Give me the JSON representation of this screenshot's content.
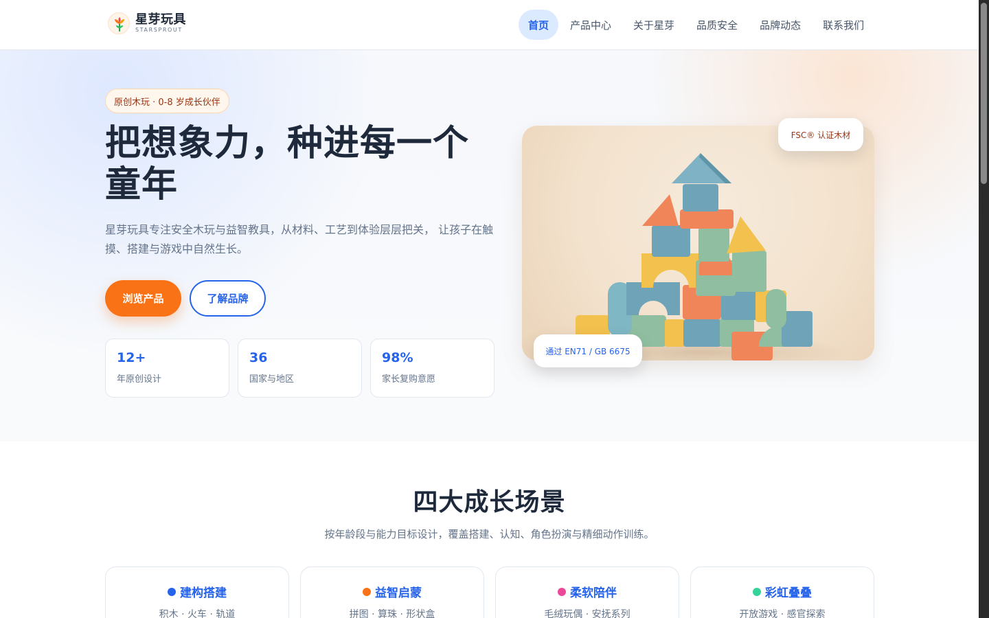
{
  "header": {
    "brand_name": "星芽玩具",
    "brand_sub": "STARSPROUT",
    "nav": [
      {
        "label": "首页",
        "active": true
      },
      {
        "label": "产品中心"
      },
      {
        "label": "关于星芽"
      },
      {
        "label": "品质安全"
      },
      {
        "label": "品牌动态"
      },
      {
        "label": "联系我们"
      }
    ]
  },
  "hero": {
    "pill": "原创木玩 · 0-8 岁成长伙伴",
    "title": "把想象力，种进每一个童年",
    "description": "星芽玩具专注安全木玩与益智教具，从材料、工艺到体验层层把关， 让孩子在触摸、搭建与游戏中自然生长。",
    "primary_button": "浏览产品",
    "secondary_button": "了解品牌",
    "stats": [
      {
        "value": "12+",
        "label": "年原创设计"
      },
      {
        "value": "36",
        "label": "国家与地区"
      },
      {
        "value": "98%",
        "label": "家长复购意愿"
      }
    ],
    "badge_top": "FSC® 认证木材",
    "badge_bottom": "通过 EN71 / GB 6675"
  },
  "section": {
    "title": "四大成长场景",
    "subtitle": "按年龄段与能力目标设计，覆盖搭建、认知、角色扮演与精细动作训练。",
    "cards": [
      {
        "title": "建构搭建",
        "tags": "积木 · 火车 · 轨道",
        "color": "#2563eb"
      },
      {
        "title": "益智启蒙",
        "tags": "拼图 · 算珠 · 形状盒",
        "color": "#f97316"
      },
      {
        "title": "柔软陪伴",
        "tags": "毛绒玩偶 · 安抚系列",
        "color": "#ec4899"
      },
      {
        "title": "彩虹叠叠",
        "tags": "开放游戏 · 感官探索",
        "color": "#34d399"
      }
    ]
  },
  "colors": {
    "primary_blue": "#2563eb",
    "accent_orange": "#f97316",
    "text_dark": "#1e293b",
    "text_muted": "#64748b"
  },
  "icons": {
    "logo": "sprout-icon"
  }
}
